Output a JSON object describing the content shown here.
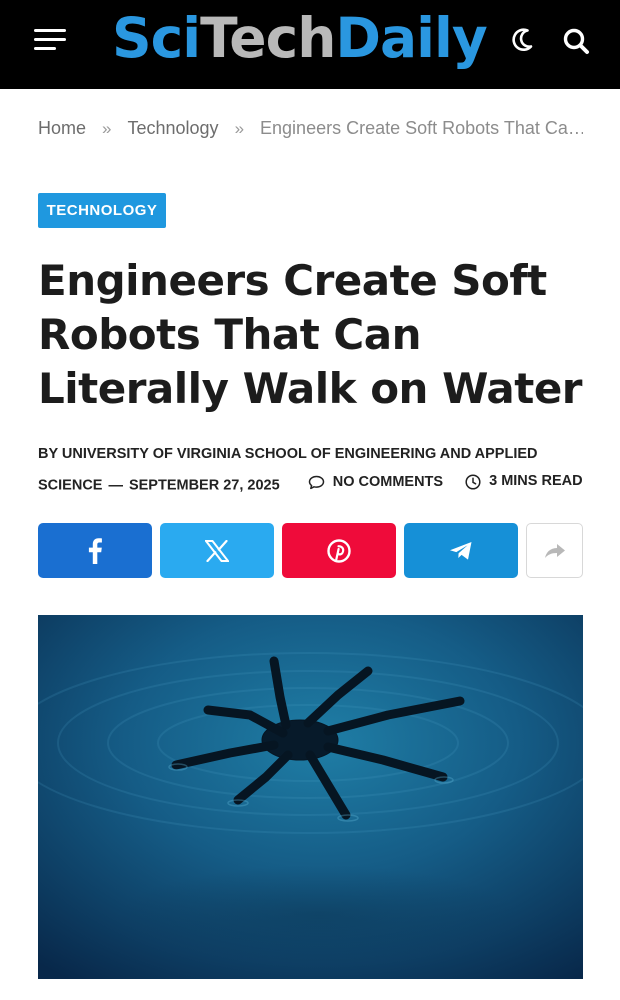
{
  "header": {
    "logo": {
      "part1": "Sci",
      "part2": "Tech",
      "part3": "Daily"
    },
    "icons": [
      "menu-icon",
      "moon-icon",
      "search-icon"
    ]
  },
  "breadcrumb": {
    "home": "Home",
    "separator": "»",
    "category": "Technology",
    "current": "Engineers Create Soft Robots That Ca…"
  },
  "article": {
    "category": "TECHNOLOGY",
    "title": "Engineers Create Soft Robots That Can Literally Walk on Water",
    "byline": "BY UNIVERSITY OF VIRGINIA SCHOOL OF ENGINEERING AND APPLIED SCIENCE",
    "date": "SEPTEMBER 27, 2025",
    "comments": "NO COMMENTS",
    "read_time": "3 MINS READ"
  },
  "share": {
    "buttons": [
      {
        "network": "facebook",
        "icon": "facebook-icon",
        "color": "#1a6fd1"
      },
      {
        "network": "x",
        "icon": "x-icon",
        "color": "#2aaaf0"
      },
      {
        "network": "pinterest",
        "icon": "pinterest-icon",
        "color": "#ef0b3a"
      },
      {
        "network": "telegram",
        "icon": "telegram-icon",
        "color": "#1690d7"
      },
      {
        "network": "more",
        "icon": "share-arrow-icon",
        "color": "#ffffff"
      }
    ]
  },
  "colors": {
    "accent": "#1f98df",
    "header_bg": "#000000",
    "logo_blue": "#2a97e0",
    "logo_gray": "#b9b9b9"
  }
}
